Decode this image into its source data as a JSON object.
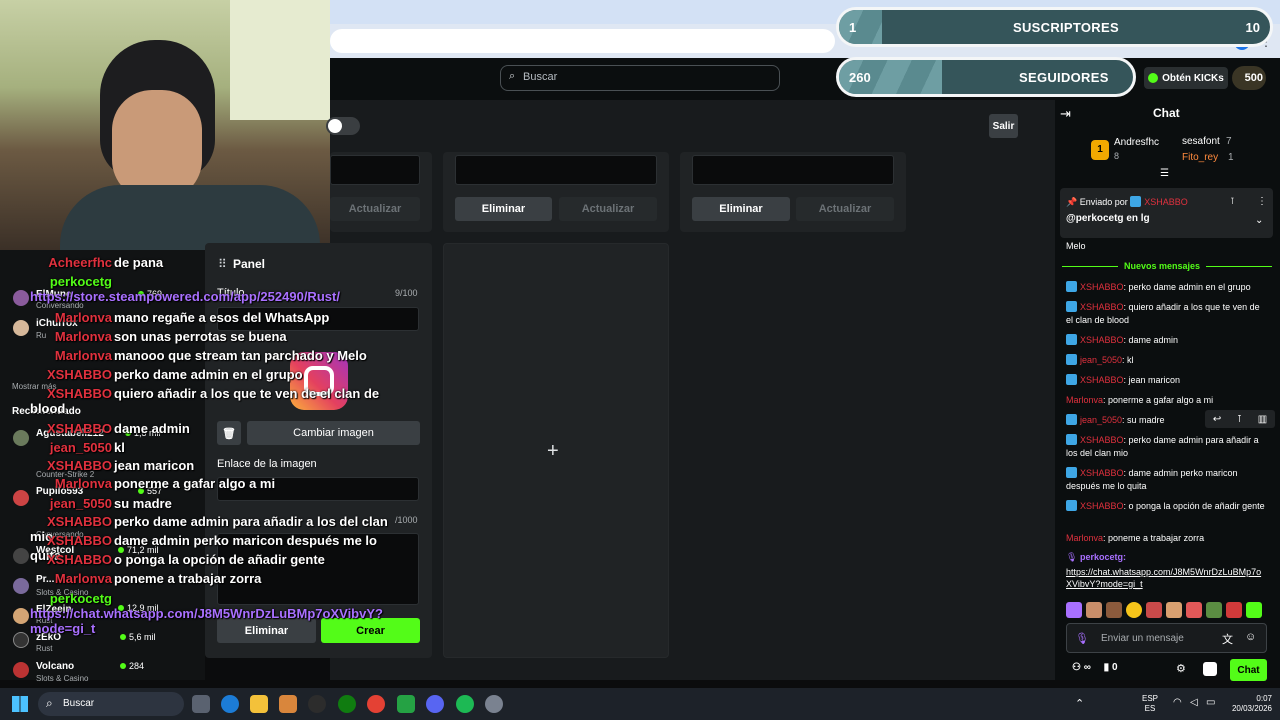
{
  "browser": {
    "toolbar_icons": [
      "star-icon",
      "extension-icon",
      "puzzle-icon",
      "download-icon",
      "profile-icon",
      "menu-icon"
    ]
  },
  "topbar": {
    "search_placeholder": "Buscar",
    "get_kicks": "Obtén KICKs",
    "kicks_count": "500"
  },
  "overlay_stats": [
    {
      "label": "SUSCRIPTORES",
      "current": "1",
      "goal": "10",
      "progress": 0.1
    },
    {
      "label": "SEGUIDORES",
      "current": "260",
      "goal": "",
      "progress": 0.35
    }
  ],
  "dashboard": {
    "exit": "Salir",
    "update": "Actualizar",
    "delete": "Eliminar",
    "panel": {
      "title": "Panel",
      "title_label": "Título",
      "title_count": "9/100",
      "title_value": "",
      "change_image": "Cambiar imagen",
      "image_link_label": "Enlace de la imagen",
      "description_count": "/1000",
      "delete": "Eliminar",
      "create": "Crear"
    }
  },
  "sidebar": {
    "show_more": "Mostrar más",
    "recommended": "Recomendado",
    "channels": [
      {
        "name": "ElMune",
        "sub": "Conversando",
        "count": "769"
      },
      {
        "name": "iChurrox",
        "sub": "Ru",
        "count": ""
      },
      {
        "name": "Agustabell212",
        "sub": "",
        "count": "1,5 mil"
      },
      {
        "name": "Pupilo593",
        "sub": "Counter-Strike 2",
        "count": "557"
      },
      {
        "name": "Westcol",
        "sub": "Conversando",
        "count": "71,2 mil"
      },
      {
        "name": "Pr...",
        "sub": "Slots & Casino",
        "count": "12,9 mil"
      },
      {
        "name": "ElZeein",
        "sub": "Rust",
        "count": ""
      },
      {
        "name": "zEkO",
        "sub": "Rust",
        "count": "5,6 mil"
      },
      {
        "name": "Volcano",
        "sub": "Slots & Casino",
        "count": "284"
      }
    ]
  },
  "stream_chat": [
    {
      "user": "Acheerfhc",
      "text": "de pana",
      "color": "#e0313e"
    },
    {
      "user": "perkocetg",
      "text": "https://store.steampowered.com/app/252490/Rust/",
      "color": "#53fc18"
    },
    {
      "user": "Marlonva",
      "text": "mano regañe a esos del WhatsApp",
      "color": "#e0313e"
    },
    {
      "user": "Marlonva",
      "text": "son unas perrotas se buena",
      "color": "#e0313e"
    },
    {
      "user": "Marlonva",
      "text": "manooo que stream tan parchado y Melo",
      "color": "#e0313e"
    },
    {
      "user": "XSHABBO",
      "text": "perko dame admin en el grupo",
      "color": "#e0313e"
    },
    {
      "user": "XSHABBO",
      "text": "quiero añadir a los que te ven de el clan de blood",
      "color": "#e0313e"
    },
    {
      "user": "XSHABBO",
      "text": "dame admin",
      "color": "#e0313e"
    },
    {
      "user": "jean_5050",
      "text": "kl",
      "color": "#e0313e"
    },
    {
      "user": "XSHABBO",
      "text": "jean maricon",
      "color": "#e0313e"
    },
    {
      "user": "Marlonva",
      "text": "ponerme a gafar algo a mi",
      "color": "#e0313e"
    },
    {
      "user": "jean_5050",
      "text": "su madre",
      "color": "#e0313e"
    },
    {
      "user": "XSHABBO",
      "text": "perko dame admin para añadir a los del clan mio",
      "color": "#e0313e"
    },
    {
      "user": "XSHABBO",
      "text": "dame admin perko maricon después me lo quita",
      "color": "#e0313e"
    },
    {
      "user": "XSHABBO",
      "text": "o ponga la opción de añadir gente",
      "color": "#e0313e"
    },
    {
      "user": "Marlonva",
      "text": "poneme a trabajar zorra",
      "color": "#e0313e"
    },
    {
      "user": "perkocetg",
      "text": "https://chat.whatsapp.com/J8M5WnrDzLuBMp7oXVibvY?mode=gi_t",
      "color": "#53fc18"
    }
  ],
  "chat": {
    "title": "Chat",
    "top_gifters": [
      {
        "name": "Andresfhc",
        "count": "8",
        "rank": "1"
      },
      {
        "name": "sesafont",
        "count": "7"
      },
      {
        "name": "Fito_rey",
        "count": "1"
      }
    ],
    "pinned": {
      "sent_by_label": "Enviado por",
      "sent_by_user": "XSHABBO",
      "message": "@perkocetg en lg"
    },
    "before_new": "Melo",
    "new_messages": "Nuevos mensajes",
    "messages": [
      {
        "user": "XSHABBO",
        "text": ": perko dame admin en el grupo"
      },
      {
        "user": "XSHABBO",
        "text": ": quiero añadir a los que te ven de el clan de blood"
      },
      {
        "user": "XSHABBO",
        "text": ": dame admin"
      },
      {
        "user": "jean_5050",
        "text": ": kl"
      },
      {
        "user": "XSHABBO",
        "text": ": jean maricon"
      },
      {
        "user": "Marlonva",
        "text": ": ponerme a gafar algo a mi"
      },
      {
        "user": "jean_5050",
        "text": ": su madre"
      },
      {
        "user": "XSHABBO",
        "text": ": perko dame admin para añadir a los del clan mio"
      },
      {
        "user": "XSHABBO",
        "text": ": dame admin perko maricon después me lo quita"
      },
      {
        "user": "XSHABBO",
        "text": ": o ponga la opción de añadir gente"
      },
      {
        "user": "Marlonva",
        "text": ": poneme a trabajar zorra"
      }
    ],
    "last_user": "perkocetg:",
    "last_link": "https://chat.whatsapp.com/J8M5WnrDzLuBMp7oXVibvY?mode=gi_t",
    "input_placeholder": "Enviar un mensaje",
    "infinity": "∞",
    "points": "0",
    "send": "Chat"
  },
  "taskbar": {
    "search": "Buscar",
    "lang1": "ESP",
    "lang2": "ES",
    "time": "0:07",
    "date": "20/03/2026"
  }
}
